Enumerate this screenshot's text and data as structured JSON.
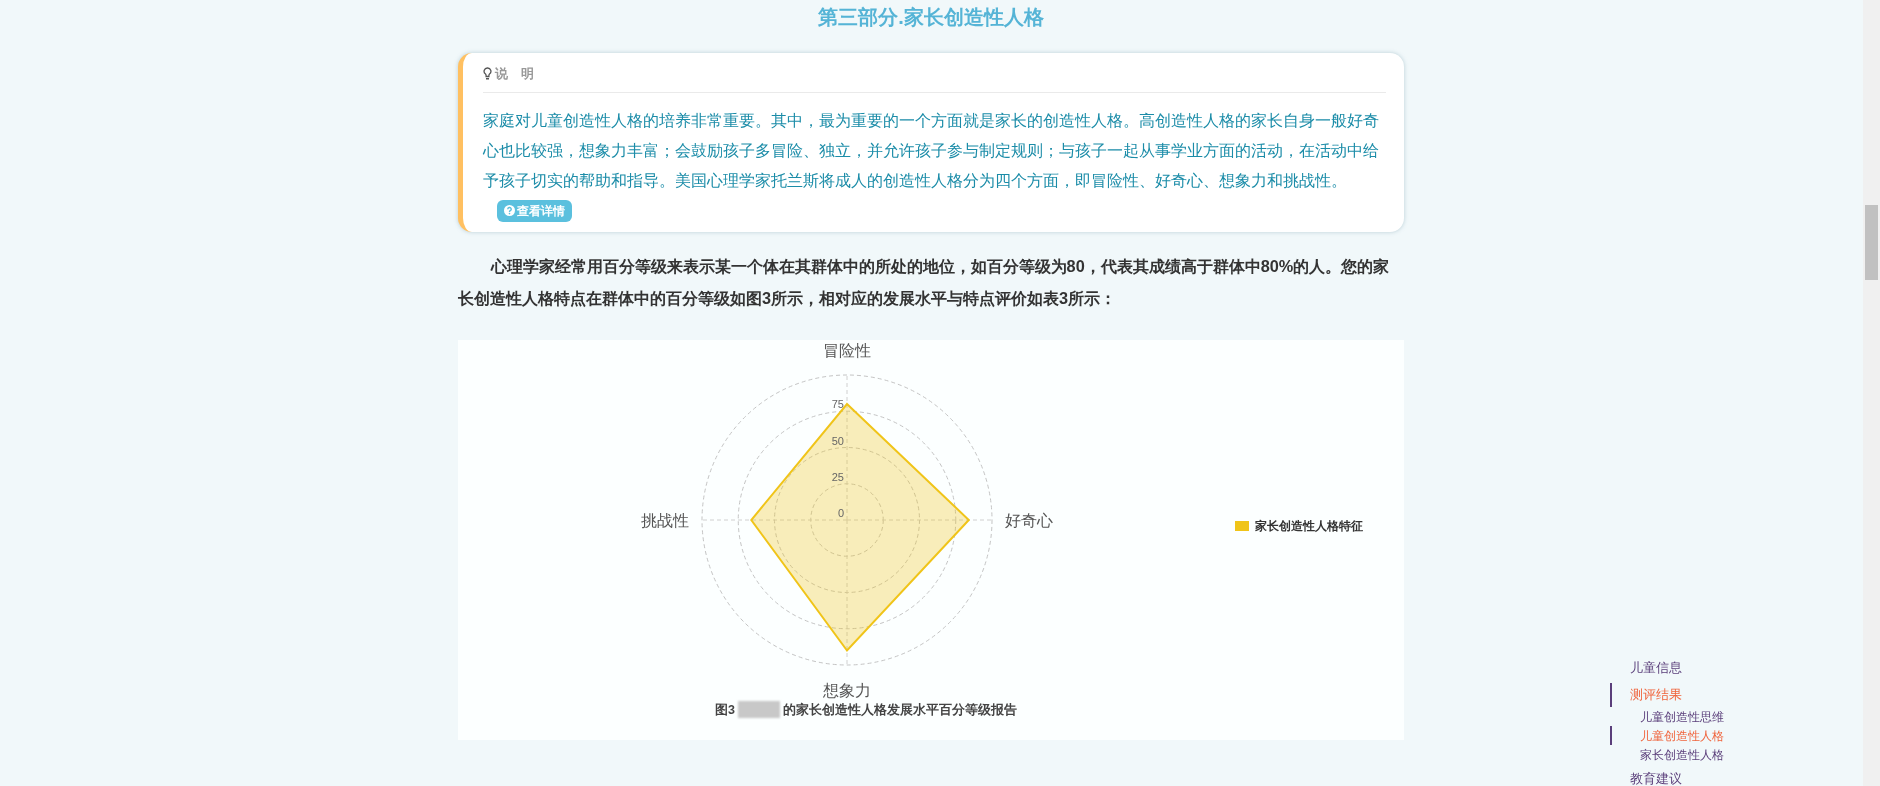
{
  "section_title": "第三部分.家长创造性人格",
  "note_card": {
    "label": "说　明",
    "body": "家庭对儿童创造性人格的培养非常重要。其中，最为重要的一个方面就是家长的创造性人格。高创造性人格的家长自身一般好奇心也比较强，想象力丰富；会鼓励孩子多冒险、独立，并允许孩子参与制定规则；与孩子一起从事学业方面的活动，在活动中给予孩子切实的帮助和指导。美国心理学家托兰斯将成人的创造性人格分为四个方面，即冒险性、好奇心、想象力和挑战性。",
    "button": "查看详情"
  },
  "paragraph": "心理学家经常用百分等级来表示某一个体在其群体中的所处的地位，如百分等级为80，代表其成绩高于群体中80%的人。您的家长创造性人格特点在群体中的百分等级如图3所示，相对应的发展水平与特点评价如表3所示：",
  "figure": {
    "caption_prefix": "图3",
    "caption_suffix": "的家长创造性人格发展水平百分等级报告",
    "chart_data": {
      "type": "radar",
      "categories": [
        "冒险性",
        "好奇心",
        "想象力",
        "挑战性"
      ],
      "ylim": [
        0,
        100
      ],
      "yticks": [
        0,
        25,
        50,
        75
      ],
      "series": [
        {
          "name": "家长创造性人格特征",
          "color": "#f0c419",
          "values": [
            80,
            84,
            90,
            66
          ]
        }
      ]
    }
  },
  "nav": [
    {
      "label": "儿童信息",
      "selected": false
    },
    {
      "label": "测评结果",
      "selected": true,
      "children": [
        {
          "label": "儿童创造性思维",
          "selected": false
        },
        {
          "label": "儿童创造性人格",
          "selected": true
        },
        {
          "label": "家长创造性人格",
          "selected": false
        }
      ]
    },
    {
      "label": "教育建议",
      "selected": false
    }
  ]
}
